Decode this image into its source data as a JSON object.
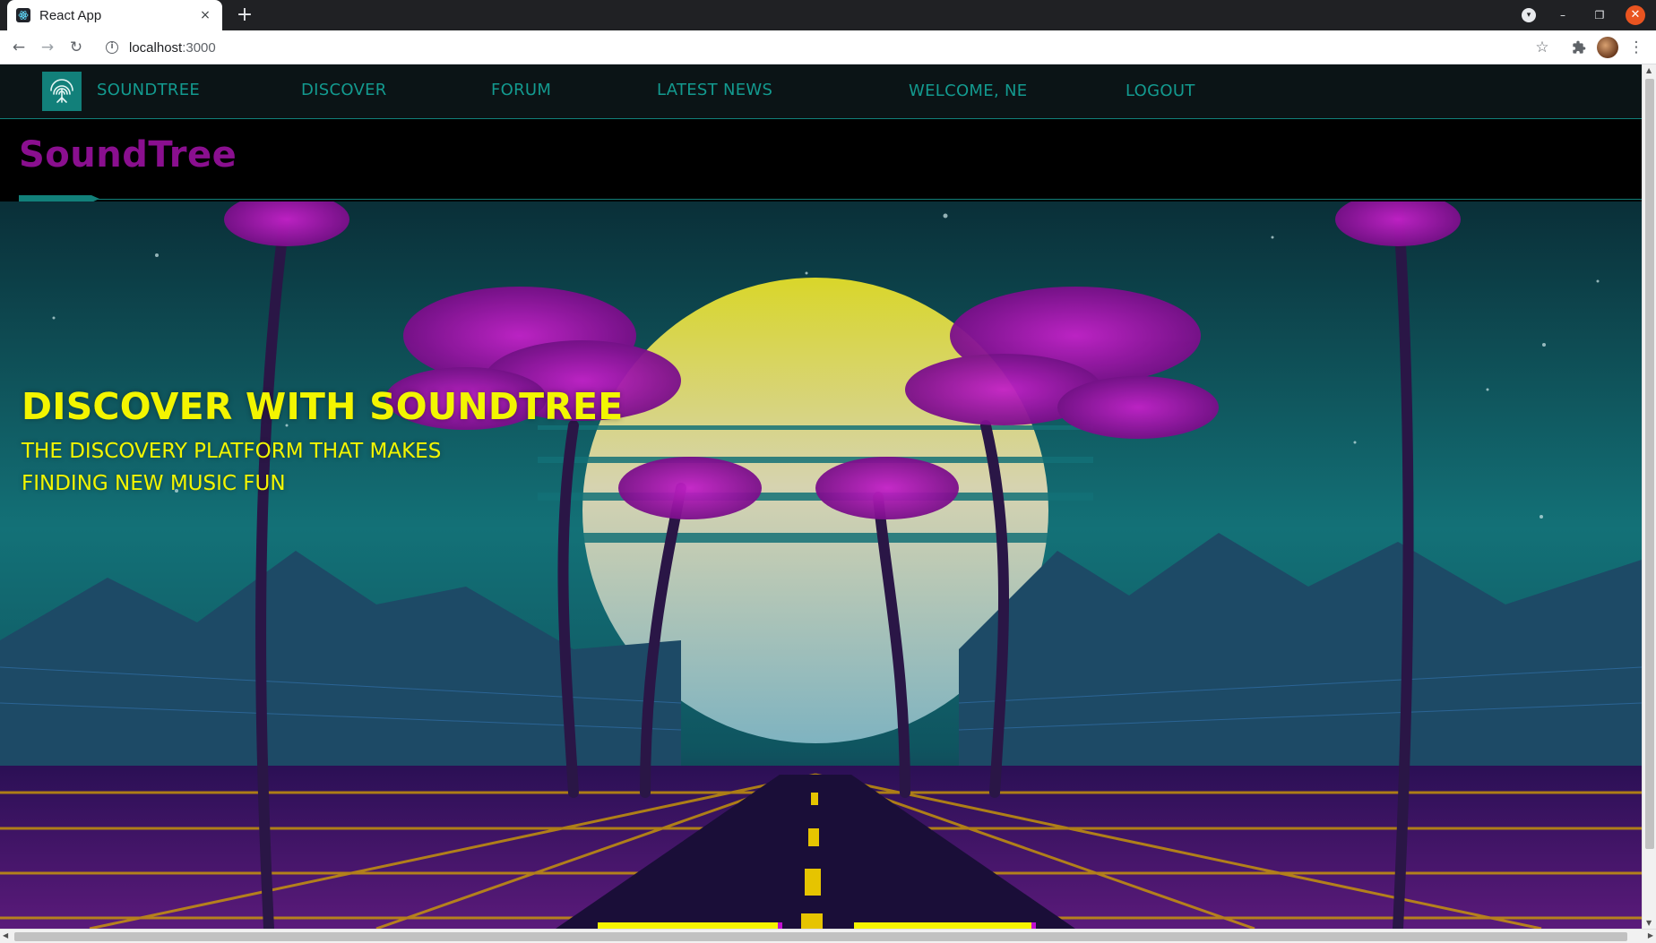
{
  "browser": {
    "tab_title": "React App",
    "tab_close_icon": "×",
    "new_tab_icon": "+",
    "url_host": "localhost",
    "url_port": ":3000",
    "back_icon": "←",
    "forward_icon": "→",
    "reload_icon": "↻",
    "star_icon": "☆",
    "extensions_icon": "puzzle-icon",
    "menu_icon": "⋮",
    "window_controls": {
      "minimize": "–",
      "restore": "❐",
      "close": "✕"
    }
  },
  "navbar": {
    "brand": "SOUNDTREE",
    "links": [
      "DISCOVER",
      "FORUM",
      "LATEST NEWS"
    ],
    "welcome": "WELCOME, NE",
    "logout": "LOGOUT"
  },
  "header": {
    "title": "SoundTree"
  },
  "hero": {
    "title": "DISCOVER WITH SOUNDTREE",
    "subtitle": "THE DISCOVERY PLATFORM THAT MAKES FINDING NEW MUSIC FUN"
  },
  "colors": {
    "teal": "#12807a",
    "nav_text": "#139a8f",
    "brand_purple": "#8a0f8f",
    "hero_yellow": "#f3f500",
    "magenta": "#c10fd0"
  }
}
